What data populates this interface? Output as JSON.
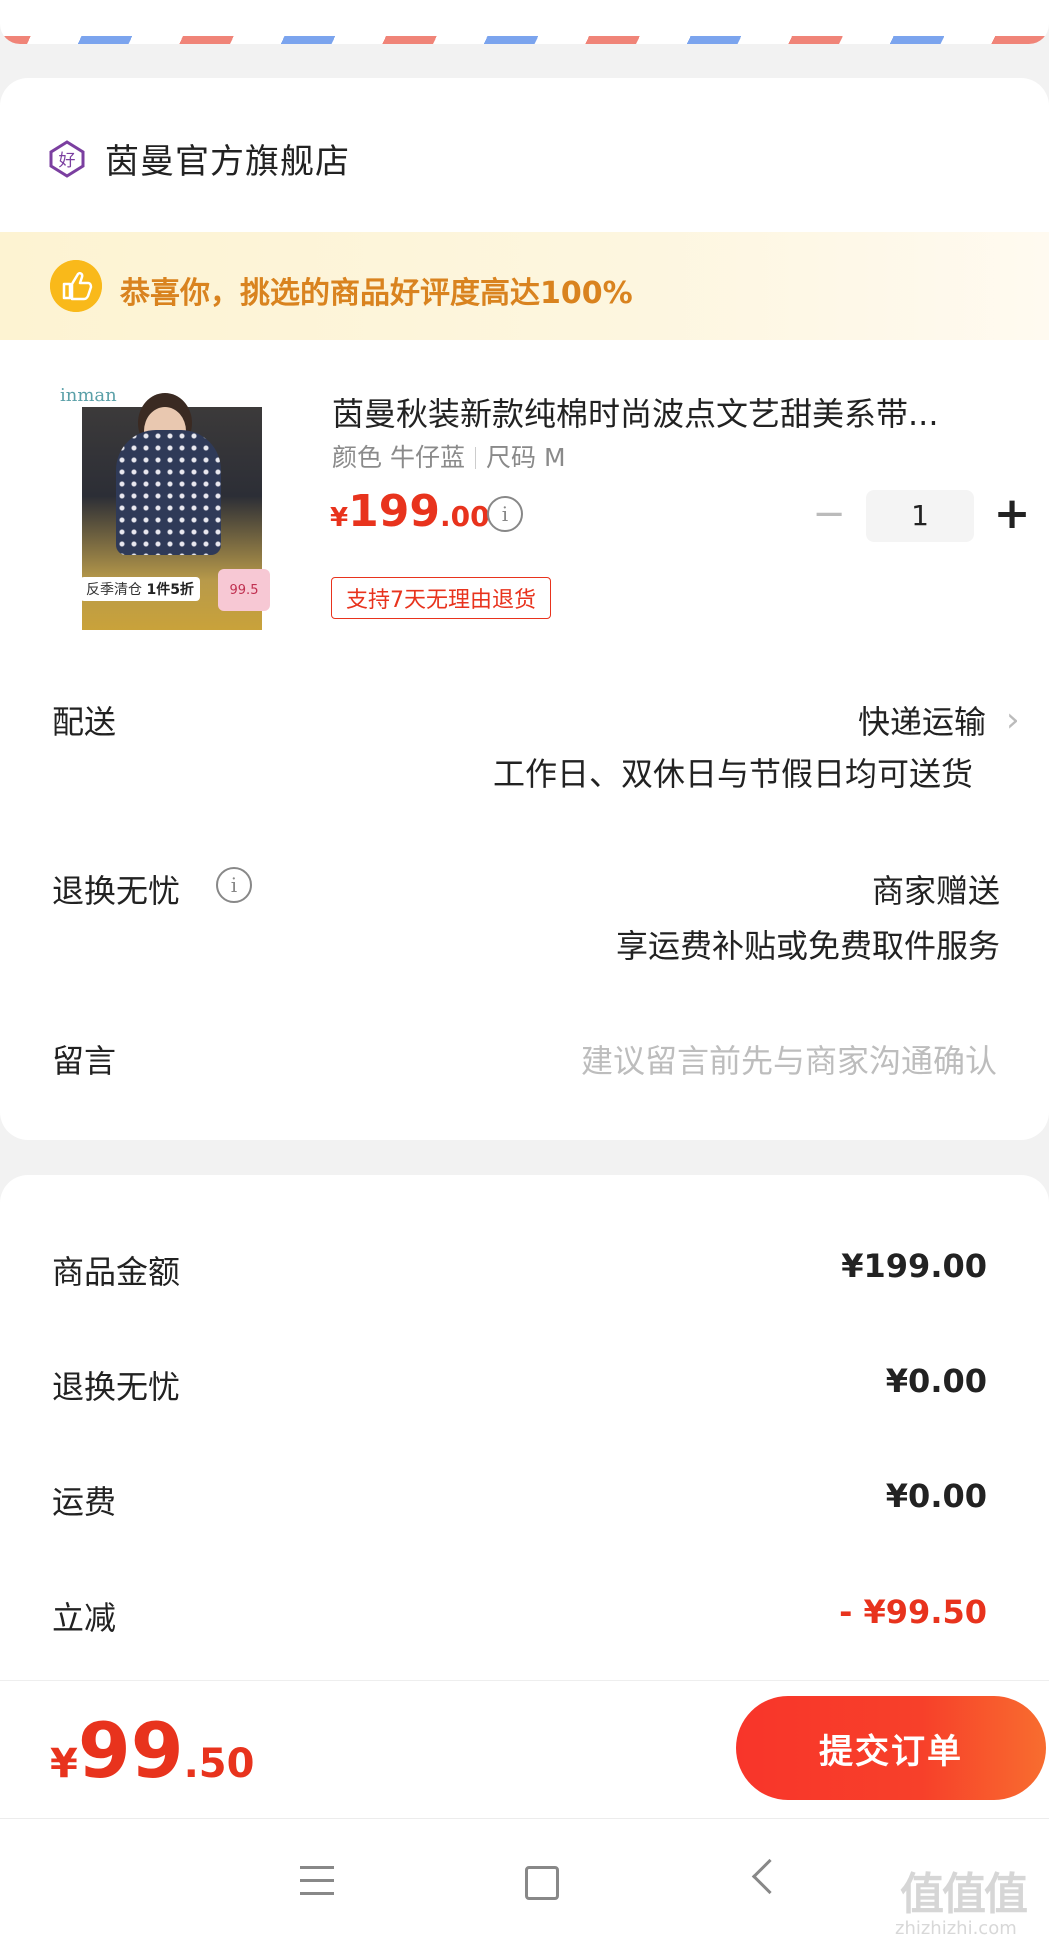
{
  "shop": {
    "icon": "shop-badge-icon",
    "badge_char": "好",
    "name": "茵曼官方旗舰店"
  },
  "banner": {
    "icon": "thumbs-up-icon",
    "text": "恭喜你，挑选的商品好评度高达100%"
  },
  "product": {
    "thumbnail": {
      "logo": "inman",
      "tag_left": "反季清仓",
      "tag_left_bold": "1件5折",
      "tag_right": "99.5"
    },
    "title": "茵曼秋装新款纯棉时尚波点文艺甜美系带...",
    "spec_color_label": "颜色",
    "spec_color_value": "牛仔蓝",
    "spec_size_label": "尺码",
    "spec_size_value": "M",
    "price_currency": "¥",
    "price_int": "199",
    "price_dec": ".00",
    "quantity": "1",
    "refund_tag": "支持7天无理由退货"
  },
  "delivery": {
    "label": "配送",
    "method": "快递运输",
    "note": "工作日、双休日与节假日均可送货"
  },
  "worry_free": {
    "label": "退换无忧",
    "value": "商家赠送",
    "note": "享运费补贴或免费取件服务"
  },
  "message": {
    "label": "留言",
    "placeholder": "建议留言前先与商家沟通确认"
  },
  "summary": {
    "goods_label": "商品金额",
    "goods_value": "¥199.00",
    "worry_label": "退换无忧",
    "worry_value": "¥0.00",
    "shipping_label": "运费",
    "shipping_value": "¥0.00",
    "discount_label": "立减",
    "discount_value": "- ¥99.50"
  },
  "footer": {
    "total_currency": "¥",
    "total_int": "99",
    "total_dec": ".50",
    "submit_label": "提交订单"
  },
  "watermark": {
    "main": "值值值",
    "sub": "zhizhizhi.com"
  },
  "colors": {
    "accent_red": "#e8331d",
    "banner_orange": "#d9831f",
    "shop_icon_purple": "#7b3fa0"
  }
}
